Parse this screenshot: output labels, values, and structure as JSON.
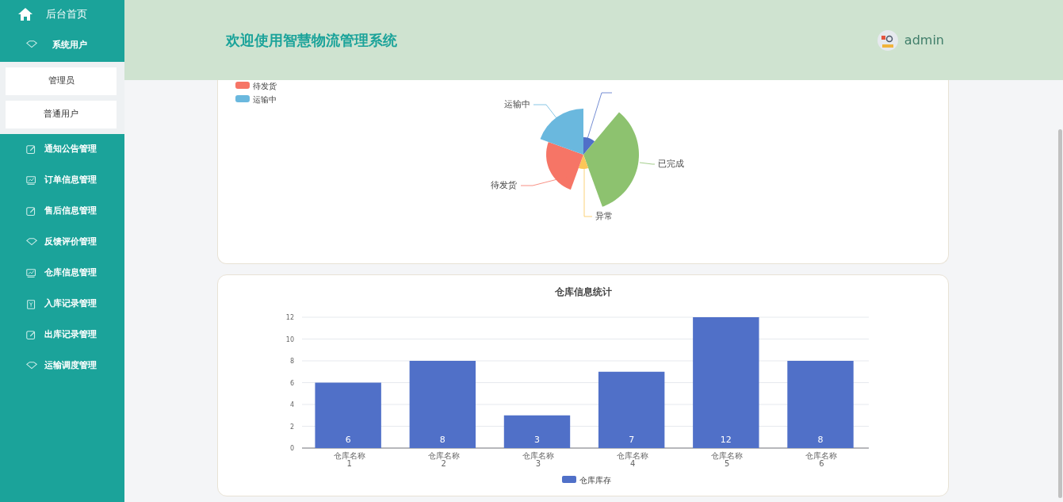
{
  "sidebar": {
    "home": "后台首页",
    "items": [
      {
        "label": "系统用户",
        "expanded": true,
        "children": [
          {
            "label": "管理员"
          },
          {
            "label": "普通用户"
          }
        ]
      },
      {
        "label": "通知公告管理"
      },
      {
        "label": "订单信息管理"
      },
      {
        "label": "售后信息管理"
      },
      {
        "label": "反馈评价管理"
      },
      {
        "label": "仓库信息管理"
      },
      {
        "label": "入库记录管理"
      },
      {
        "label": "出库记录管理"
      },
      {
        "label": "运输调度管理"
      }
    ]
  },
  "header": {
    "title": "欢迎使用智慧物流管理系统",
    "user": "admin"
  },
  "status_chart": {
    "legend": [
      {
        "label": "待发货",
        "color": "#f67566"
      },
      {
        "label": "运输中",
        "color": "#6ab8de"
      }
    ],
    "slices": [
      {
        "color": "#5070c8"
      },
      {
        "label": "已完成",
        "color": "#8dc26f"
      },
      {
        "label": "异常",
        "color": "#fbc658"
      },
      {
        "label": "待发货",
        "color": "#f67566"
      },
      {
        "label": "运输中",
        "color": "#6ab8de"
      }
    ]
  },
  "warehouse_chart": {
    "chart_data": {
      "type": "bar",
      "title": "仓库信息统计",
      "categories": [
        "仓库名称\n1",
        "仓库名称\n2",
        "仓库名称\n3",
        "仓库名称\n4",
        "仓库名称\n5",
        "仓库名称\n6"
      ],
      "series": [
        {
          "name": "仓库库存",
          "color": "#5070c8",
          "values": [
            6,
            8,
            3,
            7,
            12,
            8
          ]
        }
      ],
      "ylim": [
        0,
        12
      ],
      "grid": true,
      "yticks": [
        0,
        2,
        4,
        6,
        8,
        10,
        12
      ],
      "data_labels": true
    }
  }
}
